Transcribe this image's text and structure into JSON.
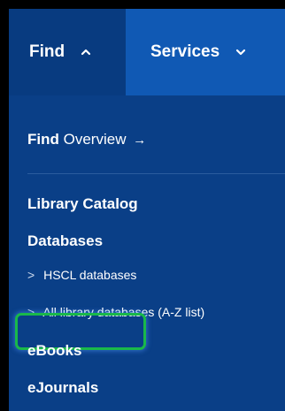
{
  "nav": {
    "tabs": [
      {
        "label": "Find",
        "chevron": "chevron-up-icon",
        "active": true
      },
      {
        "label": "Services",
        "chevron": "chevron-down-icon",
        "active": false
      }
    ]
  },
  "menu": {
    "overview": {
      "bold": "Find",
      "rest": "Overview",
      "arrow": "→"
    },
    "headings": [
      "Library Catalog",
      "Databases"
    ],
    "sub_items": [
      "HSCL databases",
      "All library databases (A-Z list)"
    ],
    "sub_caret": ">",
    "links": [
      "eBooks",
      "eJournals"
    ]
  },
  "colors": {
    "panel": "#0a3f87",
    "services_tab": "#1059b4",
    "highlight": "#19b84a"
  }
}
